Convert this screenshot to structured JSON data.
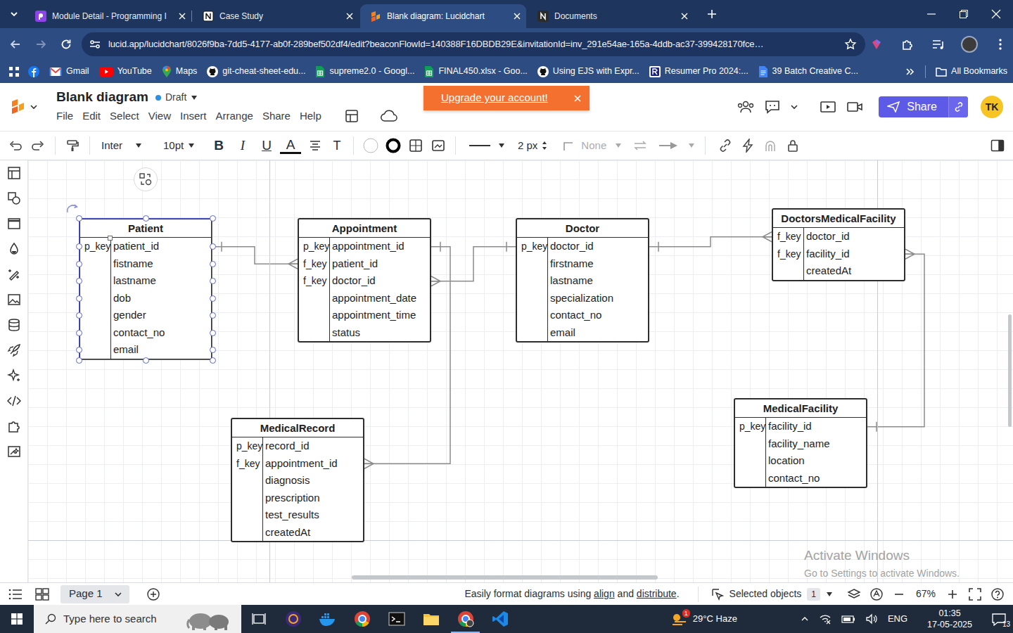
{
  "browser": {
    "tabs": [
      {
        "label": "Module Detail - Programming I",
        "kind": "module",
        "selected": false
      },
      {
        "label": "Case Study",
        "kind": "notion",
        "selected": false
      },
      {
        "label": "Blank diagram: Lucidchart",
        "kind": "lucid",
        "selected": true
      },
      {
        "label": "Documents",
        "kind": "documents",
        "selected": false
      }
    ],
    "url": "lucid.app/lucidchart/8026f9ba-7dd5-4177-ab0f-289bef502df4/edit?beaconFlowId=140388F16DBDB29E&invitationId=inv_291e54ae-165a-4ddb-ac37-399428170fce…",
    "bookmarks": [
      {
        "kind": "facebook"
      },
      {
        "label": "Gmail",
        "kind": "gmail"
      },
      {
        "label": "YouTube",
        "kind": "youtube"
      },
      {
        "label": "Maps",
        "kind": "maps"
      },
      {
        "label": "git-cheat-sheet-edu...",
        "kind": "github"
      },
      {
        "label": "supreme2.0 - Googl...",
        "kind": "sheets"
      },
      {
        "label": "FINAL450.xlsx - Goo...",
        "kind": "sheets"
      },
      {
        "label": "Using EJS with Expr...",
        "kind": "github"
      },
      {
        "label": "Resumer Pro 2024:...",
        "kind": "resumer"
      },
      {
        "label": "39 Batch Creative C...",
        "kind": "docs"
      }
    ],
    "all_bookmarks": "All Bookmarks"
  },
  "app": {
    "title": "Blank diagram",
    "status": "Draft",
    "menu": [
      "File",
      "Edit",
      "Select",
      "View",
      "Insert",
      "Arrange",
      "Share",
      "Help"
    ],
    "toast": "Upgrade your account!",
    "share": "Share",
    "avatar": "TK"
  },
  "toolbar": {
    "font": "Inter",
    "size": "10pt",
    "bold": "B",
    "italic": "I",
    "underline": "U",
    "text_color": "A",
    "text_style": "T",
    "line_width": "2 px",
    "arrow_start": {
      "text": "None",
      "disabled": true
    }
  },
  "diagram": {
    "entities": [
      {
        "name": "Patient",
        "selected": true,
        "fields": [
          {
            "key": "p_key",
            "name": "patient_id"
          },
          {
            "name": "fistname"
          },
          {
            "name": "lastname"
          },
          {
            "name": "dob"
          },
          {
            "name": "gender"
          },
          {
            "name": "contact_no"
          },
          {
            "name": "email"
          }
        ]
      },
      {
        "name": "Appointment",
        "selected": false,
        "fields": [
          {
            "key": "p_key",
            "name": "appointment_id"
          },
          {
            "key": "f_key",
            "name": "patient_id"
          },
          {
            "key": "f_key",
            "name": "doctor_id"
          },
          {
            "name": "appointment_date"
          },
          {
            "name": "appointment_time"
          },
          {
            "name": "status"
          }
        ]
      },
      {
        "name": "Doctor",
        "selected": false,
        "fields": [
          {
            "key": "p_key",
            "name": "doctor_id"
          },
          {
            "name": "firstname"
          },
          {
            "name": "lastname"
          },
          {
            "name": "specialization"
          },
          {
            "name": "contact_no"
          },
          {
            "name": "email"
          }
        ]
      },
      {
        "name": "DoctorsMedicalFacility",
        "selected": false,
        "fields": [
          {
            "key": "f_key",
            "name": "doctor_id"
          },
          {
            "key": "f_key",
            "name": "facility_id"
          },
          {
            "name": "createdAt"
          }
        ]
      },
      {
        "name": "MedicalFacility",
        "selected": false,
        "fields": [
          {
            "key": "p_key",
            "name": "facility_id"
          },
          {
            "name": "facility_name"
          },
          {
            "name": "location"
          },
          {
            "name": "contact_no"
          }
        ]
      },
      {
        "name": "MedicalRecord",
        "selected": false,
        "fields": [
          {
            "key": "p_key",
            "name": "record_id"
          },
          {
            "key": "f_key",
            "name": "appointment_id"
          },
          {
            "name": "diagnosis"
          },
          {
            "name": "prescription"
          },
          {
            "name": "test_results"
          },
          {
            "name": "createdAt"
          }
        ]
      }
    ]
  },
  "watermark": {
    "title": "Activate Windows",
    "subtitle": "Go to Settings to activate Windows."
  },
  "footer": {
    "page": "Page 1",
    "hint": [
      {
        "text": "Easily format diagrams using ",
        "link": false
      },
      {
        "text": "align",
        "link": true
      },
      {
        "text": " and ",
        "link": false
      },
      {
        "text": "distribute",
        "link": true
      },
      {
        "text": ".",
        "link": false
      }
    ],
    "selected_label": "Selected objects",
    "selected_count": "1",
    "zoom": "67%"
  },
  "taskbar": {
    "search": "Type here to search",
    "weather_badge": "1",
    "weather": "29°C Haze",
    "language": "ENG",
    "time": "01:35",
    "date": "17-05-2025",
    "notifications": "13"
  }
}
